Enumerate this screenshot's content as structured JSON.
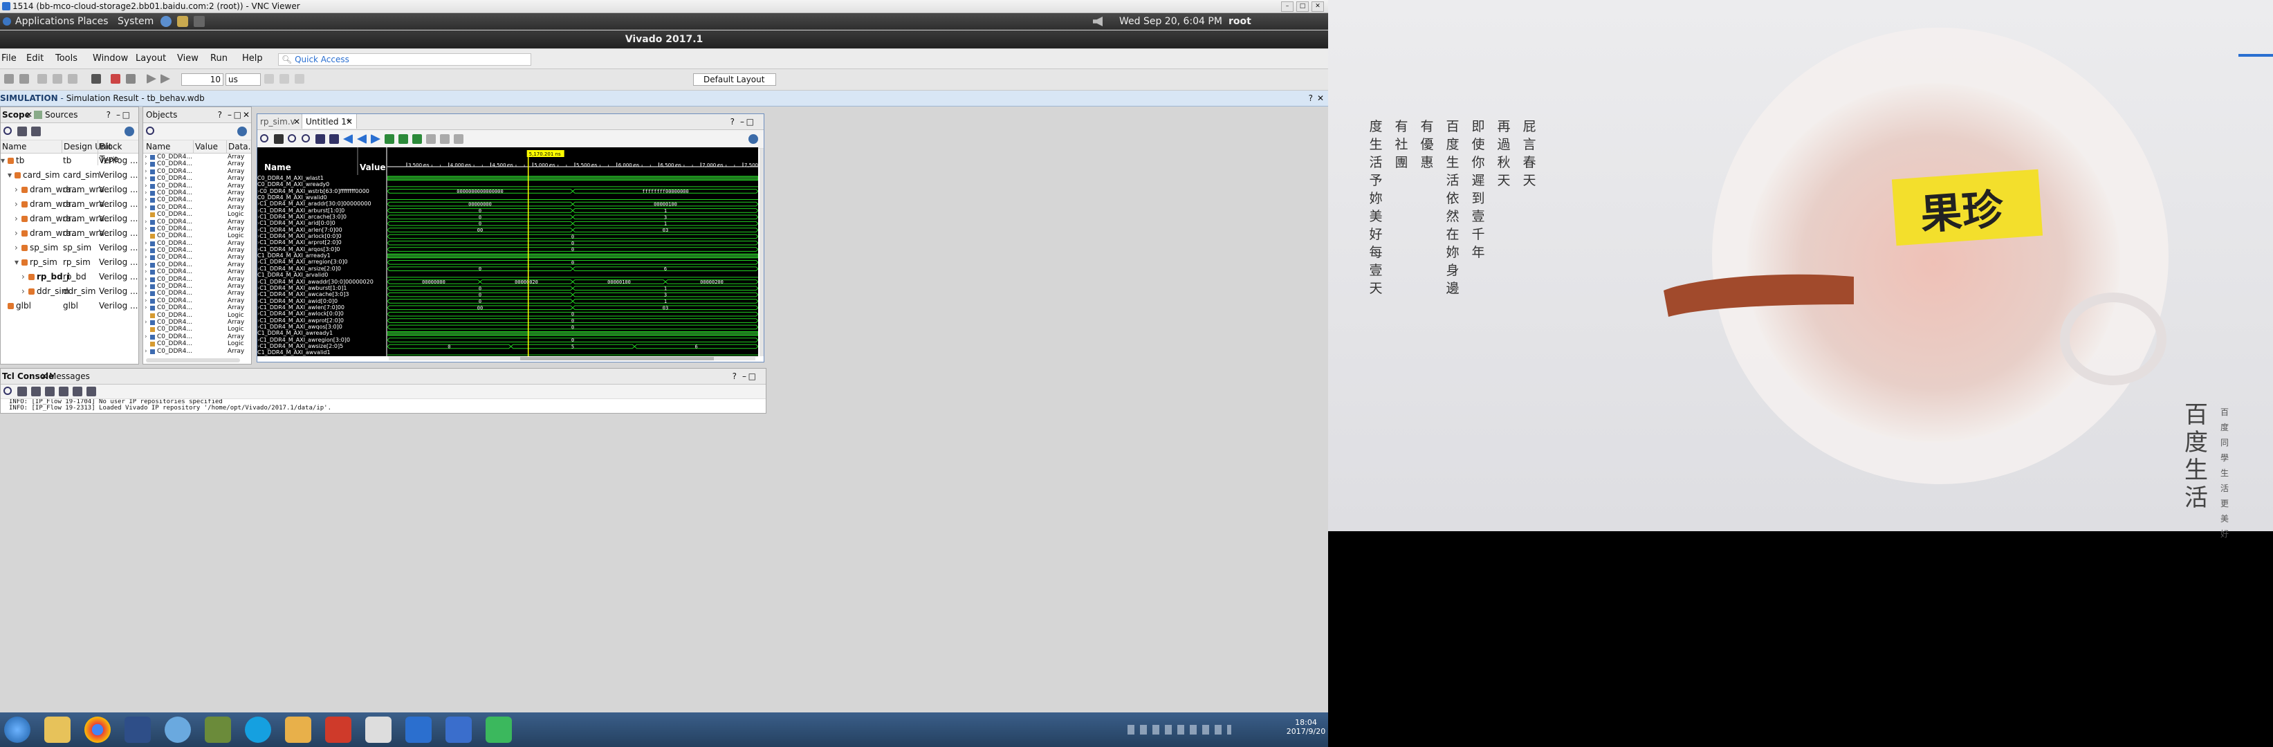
{
  "vnc": {
    "window_title": "1514 (bb-mco-cloud-storage2.bb01.baidu.com:2 (root)) - VNC Viewer",
    "gnome": {
      "applications": "Applications",
      "places": "Places",
      "system": "System",
      "clock": "Wed Sep 20,  6:04 PM",
      "user": "root"
    },
    "vivado_title": "Vivado 2017.1",
    "menu": [
      "File",
      "Edit",
      "Tools",
      "Window",
      "Layout",
      "View",
      "Run",
      "Help"
    ],
    "quick_access": "Quick Access",
    "toolbar": {
      "run_time": "10",
      "run_unit": "us",
      "layout": "Default Layout"
    },
    "sim_title": "SIMULATION",
    "sim_subtitle": "Simulation Result - tb_behav.wdb",
    "scope": {
      "tabs": [
        "Scope",
        "Sources"
      ],
      "columns": [
        "Name",
        "Design Unit",
        "Block Type"
      ],
      "rows": [
        {
          "name": "tb",
          "unit": "tb",
          "type": "Verilog ..."
        },
        {
          "name": "card_sim",
          "unit": "card_sim",
          "type": "Verilog ..."
        },
        {
          "name": "dram_wra...",
          "unit": "dram_wra...",
          "type": "Verilog ..."
        },
        {
          "name": "dram_wra...",
          "unit": "dram_wra...",
          "type": "Verilog ..."
        },
        {
          "name": "dram_wra...",
          "unit": "dram_wra...",
          "type": "Verilog ..."
        },
        {
          "name": "dram_wra...",
          "unit": "dram_wra...",
          "type": "Verilog ..."
        },
        {
          "name": "sp_sim",
          "unit": "sp_sim",
          "type": "Verilog ..."
        },
        {
          "name": "rp_sim",
          "unit": "rp_sim",
          "type": "Verilog ..."
        },
        {
          "name": "rp_bd_i",
          "unit": "rp_bd",
          "type": "Verilog ..."
        },
        {
          "name": "ddr_sim",
          "unit": "ddr_sim",
          "type": "Verilog ..."
        },
        {
          "name": "glbl",
          "unit": "glbl",
          "type": "Verilog ..."
        }
      ]
    },
    "objects": {
      "title": "Objects",
      "columns": [
        "Name",
        "Value",
        "Data..."
      ],
      "rows": [
        {
          "name": "C0_DDR4...",
          "type": "Array"
        },
        {
          "name": "C0_DDR4...",
          "type": "Array"
        },
        {
          "name": "C0_DDR4...",
          "type": "Array"
        },
        {
          "name": "C0_DDR4...",
          "type": "Array"
        },
        {
          "name": "C0_DDR4...",
          "type": "Array"
        },
        {
          "name": "C0_DDR4...",
          "type": "Array"
        },
        {
          "name": "C0_DDR4...",
          "type": "Array"
        },
        {
          "name": "C0_DDR4...",
          "type": "Array"
        },
        {
          "name": "C0_DDR4...",
          "type": "Logic"
        },
        {
          "name": "C0_DDR4...",
          "type": "Array"
        },
        {
          "name": "C0_DDR4...",
          "type": "Array"
        },
        {
          "name": "C0_DDR4...",
          "type": "Logic"
        },
        {
          "name": "C0_DDR4...",
          "type": "Array"
        },
        {
          "name": "C0_DDR4...",
          "type": "Array"
        },
        {
          "name": "C0_DDR4...",
          "type": "Array"
        },
        {
          "name": "C0_DDR4...",
          "type": "Array"
        },
        {
          "name": "C0_DDR4...",
          "type": "Array"
        },
        {
          "name": "C0_DDR4...",
          "type": "Array"
        },
        {
          "name": "C0_DDR4...",
          "type": "Array"
        },
        {
          "name": "C0_DDR4...",
          "type": "Array"
        },
        {
          "name": "C0_DDR4...",
          "type": "Array"
        },
        {
          "name": "C0_DDR4...",
          "type": "Array"
        },
        {
          "name": "C0_DDR4...",
          "type": "Logic"
        },
        {
          "name": "C0_DDR4...",
          "type": "Array"
        },
        {
          "name": "C0_DDR4...",
          "type": "Logic"
        },
        {
          "name": "C0_DDR4...",
          "type": "Array"
        },
        {
          "name": "C0_DDR4...",
          "type": "Logic"
        },
        {
          "name": "C0_DDR4...",
          "type": "Array"
        }
      ]
    },
    "wave": {
      "tabs": [
        "rp_sim.v",
        "Untitled 1*"
      ],
      "cursor_time": "5,170.201 ns",
      "columns": [
        "Name",
        "Value"
      ],
      "time_ticks": [
        "3,500 ns",
        "4,000 ns",
        "4,500 ns",
        "5,000 ns",
        "5,500 ns",
        "6,000 ns",
        "6,500 ns",
        "7,000 ns",
        "7,500 ns"
      ],
      "signals": [
        {
          "name": "C0_DDR4_M_AXI_wlast",
          "value": "1",
          "w": [
            {
              "v": "",
              "k": "1"
            }
          ]
        },
        {
          "name": "C0_DDR4_M_AXI_wready",
          "value": "0",
          "w": [
            {
              "v": "",
              "k": "0"
            }
          ]
        },
        {
          "name": "C0_DDR4_M_AXI_wstrb[63:0]",
          "value": "ffffffff0000",
          "w": [
            {
              "v": "0000000000000000",
              "k": "bus"
            },
            {
              "v": "ffffffff00000000",
              "k": "bus"
            }
          ]
        },
        {
          "name": "C0_DDR4_M_AXI_wvalid",
          "value": "0",
          "w": [
            {
              "v": "",
              "k": "0"
            }
          ]
        },
        {
          "name": "C1_DDR4_M_AXI_araddr[30:0]",
          "value": "00000000",
          "w": [
            {
              "v": "00000000",
              "k": "bus"
            },
            {
              "v": "00000100",
              "k": "bus"
            }
          ]
        },
        {
          "name": "C1_DDR4_M_AXI_arburst[1:0]",
          "value": "0",
          "w": [
            {
              "v": "0",
              "k": "bus"
            },
            {
              "v": "1",
              "k": "bus"
            }
          ]
        },
        {
          "name": "C1_DDR4_M_AXI_arcache[3:0]",
          "value": "0",
          "w": [
            {
              "v": "0",
              "k": "bus"
            },
            {
              "v": "3",
              "k": "bus"
            }
          ]
        },
        {
          "name": "C1_DDR4_M_AXI_arid[0:0]",
          "value": "0",
          "w": [
            {
              "v": "0",
              "k": "bus"
            },
            {
              "v": "1",
              "k": "bus"
            }
          ]
        },
        {
          "name": "C1_DDR4_M_AXI_arlen[7:0]",
          "value": "00",
          "w": [
            {
              "v": "00",
              "k": "bus"
            },
            {
              "v": "03",
              "k": "bus"
            }
          ]
        },
        {
          "name": "C1_DDR4_M_AXI_arlock[0:0]",
          "value": "0",
          "w": [
            {
              "v": "0",
              "k": "bus"
            }
          ]
        },
        {
          "name": "C1_DDR4_M_AXI_arprot[2:0]",
          "value": "0",
          "w": [
            {
              "v": "0",
              "k": "bus"
            }
          ]
        },
        {
          "name": "C1_DDR4_M_AXI_arqos[3:0]",
          "value": "0",
          "w": [
            {
              "v": "0",
              "k": "bus"
            }
          ]
        },
        {
          "name": "C1_DDR4_M_AXI_arready",
          "value": "1",
          "w": [
            {
              "v": "",
              "k": "1"
            }
          ]
        },
        {
          "name": "C1_DDR4_M_AXI_arregion[3:0]",
          "value": "0",
          "w": [
            {
              "v": "0",
              "k": "bus"
            }
          ]
        },
        {
          "name": "C1_DDR4_M_AXI_arsize[2:0]",
          "value": "0",
          "w": [
            {
              "v": "0",
              "k": "bus"
            },
            {
              "v": "6",
              "k": "bus"
            }
          ]
        },
        {
          "name": "C1_DDR4_M_AXI_arvalid",
          "value": "0",
          "w": [
            {
              "v": "",
              "k": "0"
            }
          ]
        },
        {
          "name": "C1_DDR4_M_AXI_awaddr[30:0]",
          "value": "00000020",
          "w": [
            {
              "v": "00000000",
              "k": "bus"
            },
            {
              "v": "00000020",
              "k": "bus"
            },
            {
              "v": "00000100",
              "k": "bus"
            },
            {
              "v": "00000200",
              "k": "bus"
            }
          ]
        },
        {
          "name": "C1_DDR4_M_AXI_awburst[1:0]",
          "value": "1",
          "w": [
            {
              "v": "0",
              "k": "bus"
            },
            {
              "v": "1",
              "k": "bus"
            }
          ]
        },
        {
          "name": "C1_DDR4_M_AXI_awcache[3:0]",
          "value": "3",
          "w": [
            {
              "v": "0",
              "k": "bus"
            },
            {
              "v": "3",
              "k": "bus"
            }
          ]
        },
        {
          "name": "C1_DDR4_M_AXI_awid[0:0]",
          "value": "0",
          "w": [
            {
              "v": "0",
              "k": "bus"
            },
            {
              "v": "1",
              "k": "bus"
            }
          ]
        },
        {
          "name": "C1_DDR4_M_AXI_awlen[7:0]",
          "value": "00",
          "w": [
            {
              "v": "00",
              "k": "bus"
            },
            {
              "v": "03",
              "k": "bus"
            }
          ]
        },
        {
          "name": "C1_DDR4_M_AXI_awlock[0:0]",
          "value": "0",
          "w": [
            {
              "v": "0",
              "k": "bus"
            }
          ]
        },
        {
          "name": "C1_DDR4_M_AXI_awprot[2:0]",
          "value": "0",
          "w": [
            {
              "v": "0",
              "k": "bus"
            }
          ]
        },
        {
          "name": "C1_DDR4_M_AXI_awqos[3:0]",
          "value": "0",
          "w": [
            {
              "v": "0",
              "k": "bus"
            }
          ]
        },
        {
          "name": "C1_DDR4_M_AXI_awready",
          "value": "1",
          "w": [
            {
              "v": "",
              "k": "1"
            }
          ]
        },
        {
          "name": "C1_DDR4_M_AXI_awregion[3:0]",
          "value": "0",
          "w": [
            {
              "v": "0",
              "k": "bus"
            }
          ]
        },
        {
          "name": "C1_DDR4_M_AXI_awsize[2:0]",
          "value": "5",
          "w": [
            {
              "v": "0",
              "k": "bus"
            },
            {
              "v": "5",
              "k": "bus"
            },
            {
              "v": "6",
              "k": "bus"
            }
          ]
        },
        {
          "name": "C1_DDR4_M_AXI_awvalid",
          "value": "1",
          "w": [
            {
              "v": "",
              "k": "0"
            }
          ]
        }
      ]
    },
    "tcl": {
      "tabs": [
        "Tcl Console",
        "Messages"
      ],
      "lines": [
        "INFO: [IP_Flow 19-1704] No user IP repositories specified",
        "INFO: [IP_Flow 19-2313] Loaded Vivado IP repository '/home/opt/Vivado/2017.1/data/ip'."
      ]
    },
    "taskbar": {
      "time": "18:04",
      "date": "2017/9/20"
    }
  },
  "photo": {
    "poem": [
      "屁言春天",
      "再過秋天",
      "即使你遲到壹千年",
      "百度生活依然在妳身邊",
      "有優惠",
      "有社團",
      "度生活予妳美好每壹天"
    ],
    "label": "果珍",
    "brand": "百度生活",
    "brand_sub": "百度同學生活更美好"
  },
  "colors": {
    "wave_green": "#22d422",
    "cursor": "#ffff00",
    "wave_bg": "#000000",
    "vivado_accent": "#2a6fd1"
  }
}
